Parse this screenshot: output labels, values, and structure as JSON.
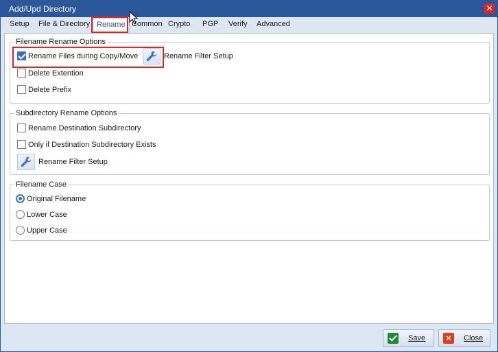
{
  "window": {
    "title": "Add/Upd Directory",
    "close_glyph": "✕"
  },
  "tabs": [
    {
      "label": "Setup"
    },
    {
      "label": "File & Directory"
    },
    {
      "label": "Rename",
      "active": true
    },
    {
      "label": "Common"
    },
    {
      "label": "Crypto"
    },
    {
      "label": "PGP"
    },
    {
      "label": "Verify"
    },
    {
      "label": "Advanced"
    }
  ],
  "filename_rename": {
    "title": "Filename Rename Options",
    "rename_files": {
      "label": "Rename Files during Copy/Move",
      "checked": true
    },
    "filter_setup_label": "Rename Filter Setup",
    "delete_extension": {
      "label": "Delete Extention",
      "checked": false
    },
    "delete_prefix": {
      "label": "Delete Prefix",
      "checked": false
    }
  },
  "subdir_rename": {
    "title": "Subdirectory Rename Options",
    "rename_dest": {
      "label": "Rename Destination Subdirectory",
      "checked": false
    },
    "only_if_exists": {
      "label": "Only if Destination Subdirectory Exists",
      "checked": false
    },
    "filter_setup_label": "Rename Filter Setup"
  },
  "filename_case": {
    "title": "Filename Case",
    "options": [
      {
        "label": "Original Filename",
        "selected": true
      },
      {
        "label": "Lower Case",
        "selected": false
      },
      {
        "label": "Upper Case",
        "selected": false
      }
    ]
  },
  "footer": {
    "save_label": "Save",
    "close_label": "Close",
    "close_glyph": "✕"
  },
  "colors": {
    "accent": "#2b579a",
    "highlight": "#e02323",
    "save_icon": "#1f8a2f",
    "close_icon": "#d9401f"
  },
  "icons": [
    "wrench-icon",
    "checkmark-icon",
    "close-icon",
    "mouse-cursor-icon"
  ]
}
